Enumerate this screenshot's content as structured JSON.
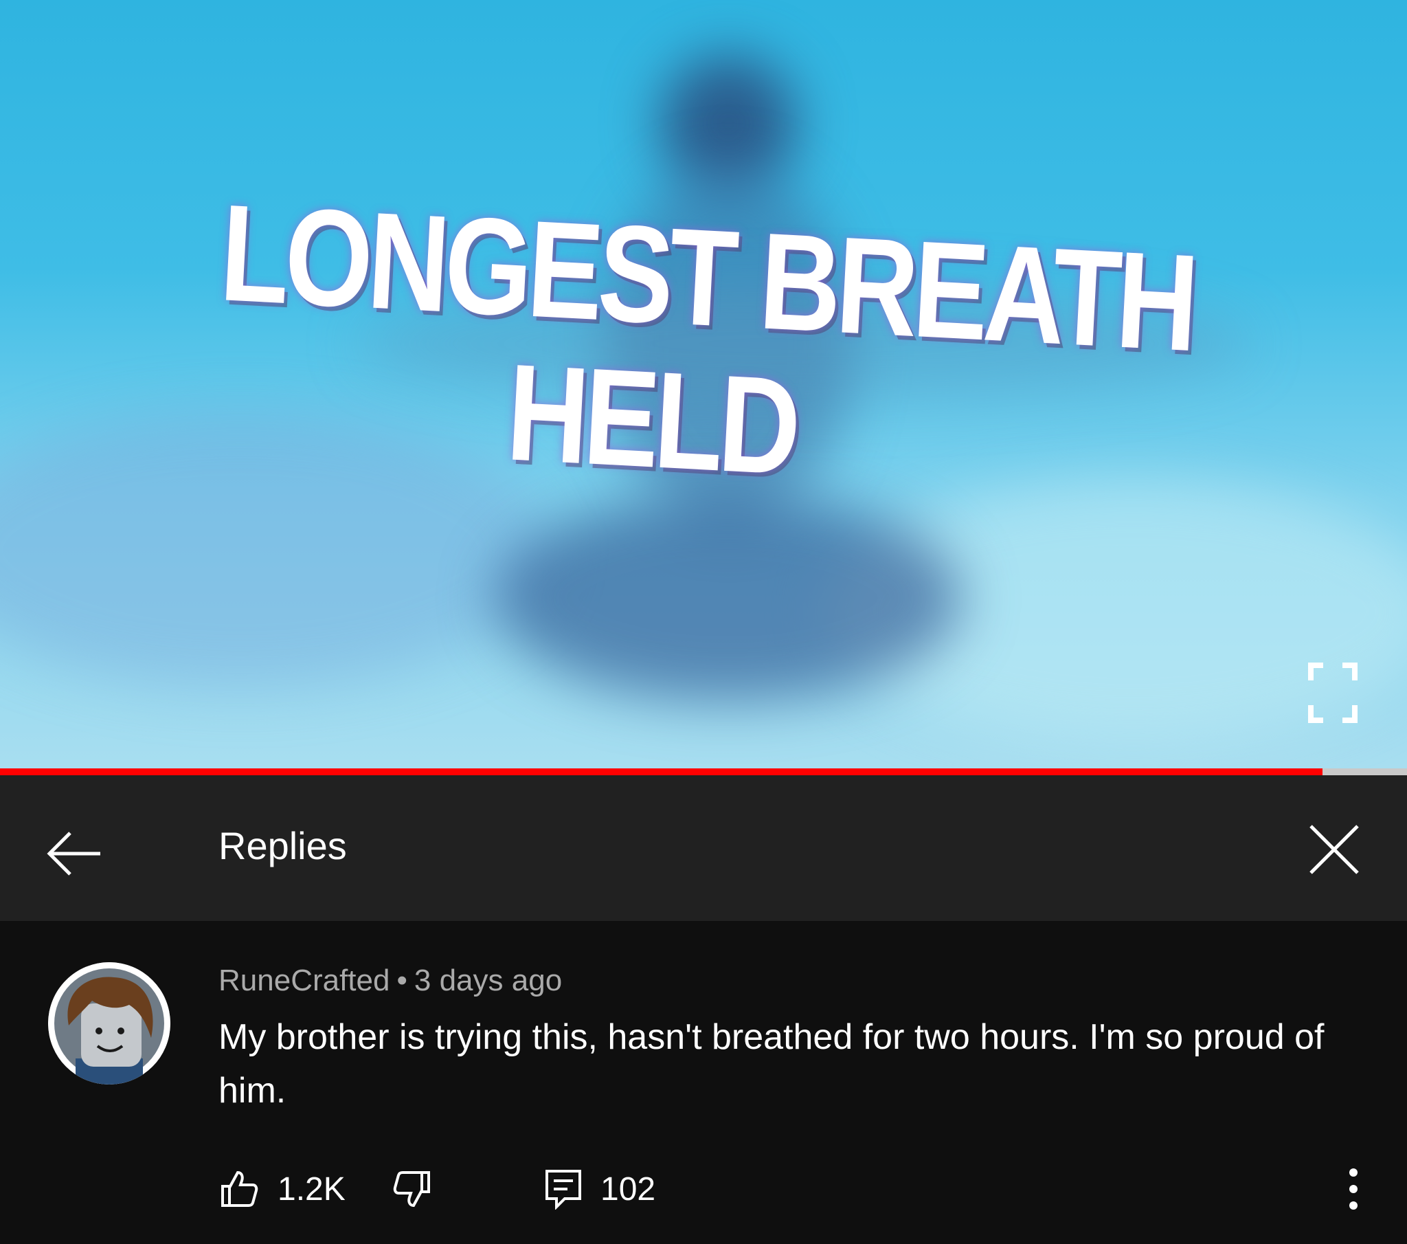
{
  "video": {
    "thumbnail_title_line1": "LONGEST BREATH",
    "thumbnail_title_line2": "HELD",
    "progress": 0.94
  },
  "header": {
    "title": "Replies"
  },
  "comment": {
    "author": "RuneCrafted",
    "separator": "•",
    "time": "3 days ago",
    "text": "My brother is trying this, hasn't breathed for two hours. I'm so proud of him.",
    "likes": "1.2K",
    "replies": "102"
  },
  "colors": {
    "accent": "#ff0000",
    "header_bg": "#212121",
    "page_bg": "#0f0f0f"
  },
  "icons": [
    "back-arrow-icon",
    "close-icon",
    "fullscreen-icon",
    "thumbs-up-icon",
    "thumbs-down-icon",
    "reply-icon",
    "more-vert-icon"
  ]
}
